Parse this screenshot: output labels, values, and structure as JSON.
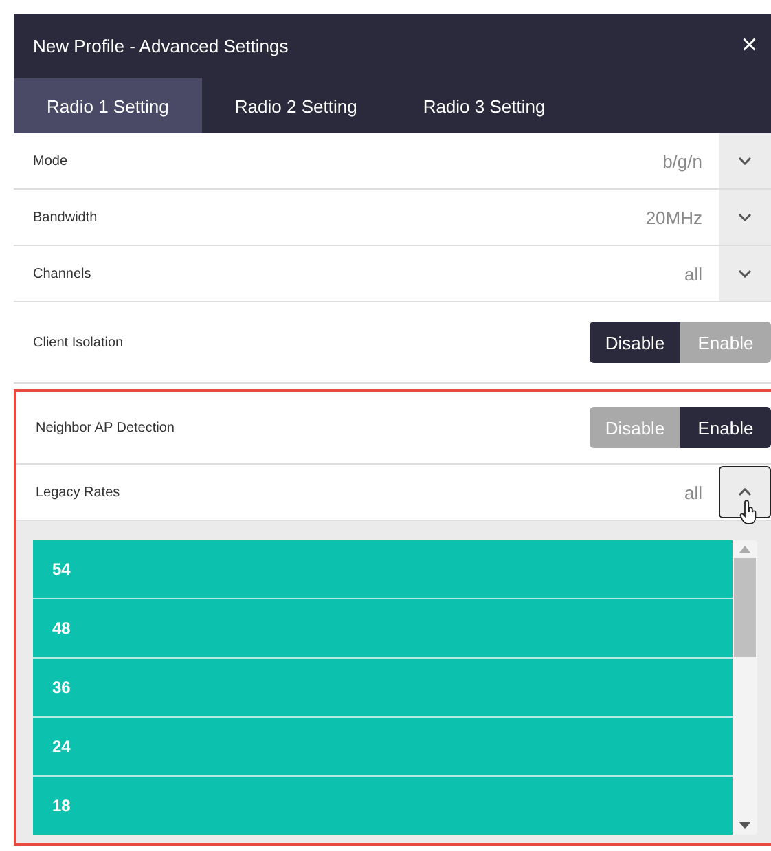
{
  "window": {
    "title": "New Profile - Advanced Settings",
    "close": "×"
  },
  "tabs": [
    {
      "label": "Radio 1 Setting",
      "selected": true
    },
    {
      "label": "Radio 2 Setting",
      "selected": false
    },
    {
      "label": "Radio 3 Setting",
      "selected": false
    }
  ],
  "settings": [
    {
      "kind": "select",
      "label": "Mode",
      "value": "b/g/n",
      "expanded": false,
      "highlighted": false
    },
    {
      "kind": "select",
      "label": "Bandwidth",
      "value": "20MHz",
      "expanded": false,
      "highlighted": false
    },
    {
      "kind": "select",
      "label": "Channels",
      "value": "all",
      "expanded": false,
      "highlighted": false
    },
    {
      "kind": "toggle",
      "label": "Client Isolation",
      "options": [
        {
          "label": "Disable",
          "selected": true
        },
        {
          "label": "Enable",
          "selected": false
        }
      ],
      "highlighted": false
    },
    {
      "kind": "toggle",
      "label": "Neighbor AP Detection",
      "options": [
        {
          "label": "Disable",
          "selected": false
        },
        {
          "label": "Enable",
          "selected": true
        }
      ],
      "highlighted": true
    },
    {
      "kind": "select",
      "label": "Legacy Rates",
      "value": "all",
      "expanded": true,
      "highlighted": true,
      "options": [
        {
          "label": "54",
          "selected": true
        },
        {
          "label": "48",
          "selected": true
        },
        {
          "label": "36",
          "selected": true
        },
        {
          "label": "24",
          "selected": true
        },
        {
          "label": "18",
          "selected": true
        }
      ]
    }
  ]
}
